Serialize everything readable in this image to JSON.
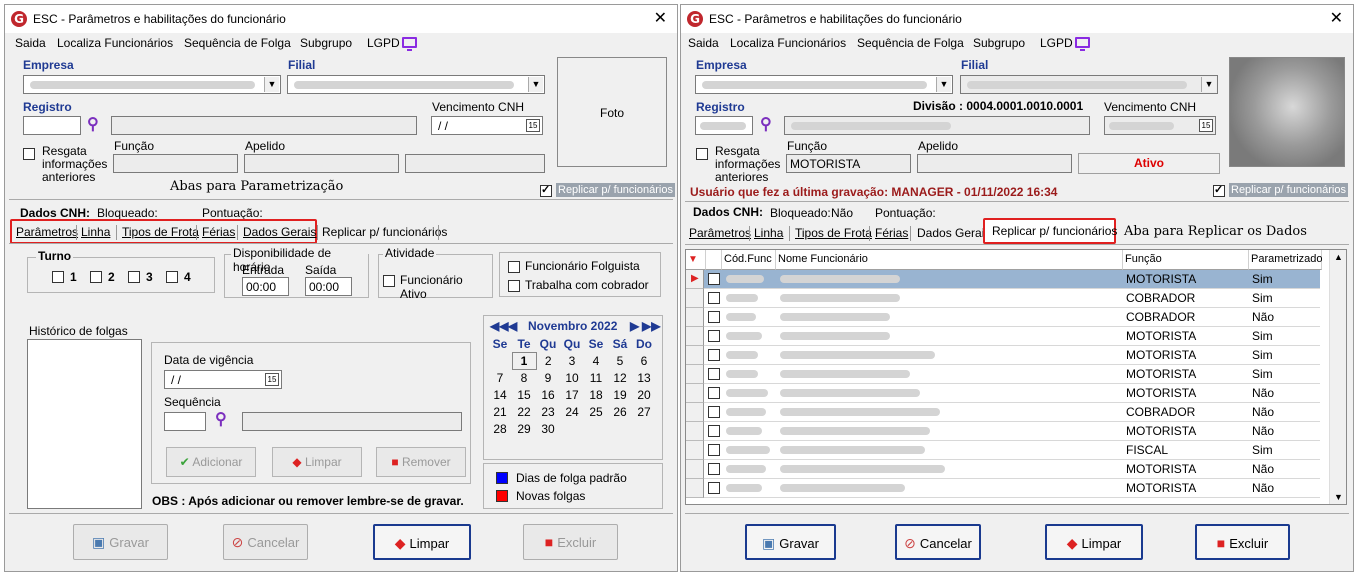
{
  "left": {
    "title": "ESC - Parâmetros e habilitações do funcionário",
    "menu": [
      "Saida",
      "Localiza Funcionários",
      "Sequência de Folga",
      "Subgrupo",
      "LGPD"
    ],
    "labels": {
      "empresa": "Empresa",
      "filial": "Filial",
      "registro": "Registro",
      "vencimento_cnh": "Vencimento CNH",
      "vencimento_value": " / /",
      "foto": "Foto",
      "resgata": "Resgata informações anteriores",
      "funcao": "Função",
      "apelido": "Apelido",
      "replicar_chk": "Replicar p/ funcionários",
      "dados_cnh": "Dados CNH:",
      "bloqueado": "Bloqueado:",
      "pontuacao": "Pontuação:"
    },
    "annotation": "Abas para Parametrização",
    "tabs": [
      "Parâmetros",
      "Linha",
      "Tipos de Frota",
      "Férias",
      "Dados Gerais",
      "Replicar p/ funcionários"
    ],
    "turno": {
      "title": "Turno",
      "options": [
        "1",
        "2",
        "3",
        "4"
      ]
    },
    "disponibilidade": {
      "title": "Disponibilidade de horário",
      "entrada": "Entrada",
      "saida": "Saída",
      "entrada_value": "00:00",
      "saida_value": "00:00"
    },
    "atividade": {
      "title": "Atividade",
      "funcionario_ativo": "Funcionário Ativo"
    },
    "folguista": "Funcionário Folguista",
    "cobrador": "Trabalha com cobrador",
    "historico": "Histórico de folgas",
    "data_vigencia": "Data de vigência",
    "data_vigencia_value": " / /",
    "sequencia": "Sequência",
    "btn_adicionar": "Adicionar",
    "btn_limpar": "Limpar",
    "btn_remover": "Remover",
    "obs": "OBS : Após adicionar ou  remover lembre-se de gravar.",
    "calendar": {
      "month": "Novembro 2022",
      "weekdays": [
        "Se",
        "Te",
        "Qu",
        "Qu",
        "Se",
        "Sá",
        "Do"
      ],
      "weeks": [
        [
          "",
          "1",
          "2",
          "3",
          "4",
          "5",
          "6"
        ],
        [
          "7",
          "8",
          "9",
          "10",
          "11",
          "12",
          "13"
        ],
        [
          "14",
          "15",
          "16",
          "17",
          "18",
          "19",
          "20"
        ],
        [
          "21",
          "22",
          "23",
          "24",
          "25",
          "26",
          "27"
        ],
        [
          "28",
          "29",
          "30",
          "",
          "",
          "",
          ""
        ]
      ]
    },
    "legend": [
      {
        "label": "Dias de folga padrão",
        "color": "#0000ff"
      },
      {
        "label": "Novas folgas",
        "color": "#ff0000"
      }
    ],
    "bottom_buttons": [
      "Gravar",
      "Cancelar",
      "Limpar",
      "Excluir"
    ]
  },
  "right": {
    "title": "ESC - Parâmetros e habilitações do funcionário",
    "menu": [
      "Saida",
      "Localiza Funcionários",
      "Sequência de Folga",
      "Subgrupo",
      "LGPD"
    ],
    "labels": {
      "empresa": "Empresa",
      "filial": "Filial",
      "registro": "Registro",
      "divisao": "Divisão : 0004.0001.0010.0001",
      "vencimento_cnh": "Vencimento CNH",
      "resgata": "Resgata informações anteriores",
      "funcao": "Função",
      "funcao_value": "MOTORISTA",
      "apelido": "Apelido",
      "ativo": "Ativo",
      "ultima_gravacao": "Usuário que fez a última gravação: MANAGER - 01/11/2022 16:34",
      "replicar_chk": "Replicar p/ funcionários",
      "dados_cnh": "Dados CNH:",
      "bloqueado": "Bloqueado:",
      "bloqueado_value": "Não",
      "pontuacao": "Pontuação:"
    },
    "annotation": "Aba para Replicar os Dados",
    "tabs": [
      "Parâmetros",
      "Linha",
      "Tipos de Frota",
      "Férias",
      "Dados Gerais",
      "Replicar p/ funcionários"
    ],
    "grid": {
      "headers": [
        "Cód.Func",
        "Nome Funcionário",
        "Função",
        "Parametrizado"
      ],
      "rows": [
        {
          "funcao": "MOTORISTA",
          "param": "Sim"
        },
        {
          "funcao": "COBRADOR",
          "param": "Sim"
        },
        {
          "funcao": "COBRADOR",
          "param": "Não"
        },
        {
          "funcao": "MOTORISTA",
          "param": "Sim"
        },
        {
          "funcao": "MOTORISTA",
          "param": "Sim"
        },
        {
          "funcao": "MOTORISTA",
          "param": "Sim"
        },
        {
          "funcao": "MOTORISTA",
          "param": "Não"
        },
        {
          "funcao": "COBRADOR",
          "param": "Não"
        },
        {
          "funcao": "MOTORISTA",
          "param": "Não"
        },
        {
          "funcao": "FISCAL",
          "param": "Sim"
        },
        {
          "funcao": "MOTORISTA",
          "param": "Não"
        },
        {
          "funcao": "MOTORISTA",
          "param": "Não"
        }
      ]
    },
    "bottom_buttons": [
      "Gravar",
      "Cancelar",
      "Limpar",
      "Excluir"
    ]
  }
}
